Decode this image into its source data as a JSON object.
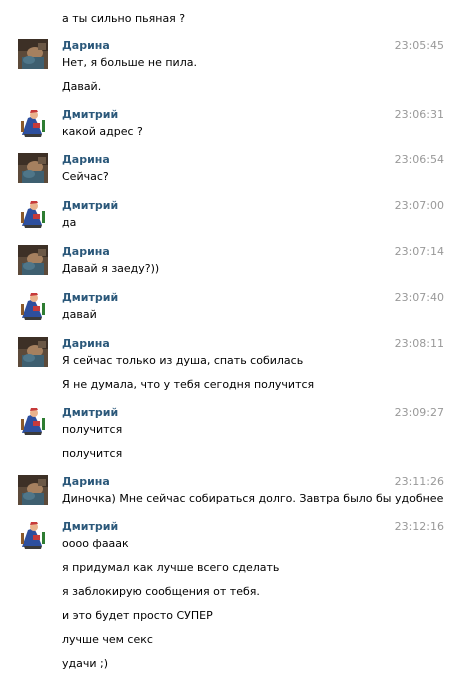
{
  "colors": {
    "author": "#2b587a",
    "time": "#999999",
    "text": "#000000",
    "background": "#ffffff"
  },
  "top_line": "а ты сильно пьяная ?",
  "messages": [
    {
      "author": "Дарина",
      "avatar": "darina-avatar",
      "time": "23:05:45",
      "lines": [
        "Нет, я больше не пила.",
        "Давай."
      ]
    },
    {
      "author": "Дмитрий",
      "avatar": "dmitry-avatar",
      "time": "23:06:31",
      "lines": [
        "какой адрес ?"
      ]
    },
    {
      "author": "Дарина",
      "avatar": "darina-avatar",
      "time": "23:06:54",
      "lines": [
        "Сейчас?"
      ]
    },
    {
      "author": "Дмитрий",
      "avatar": "dmitry-avatar",
      "time": "23:07:00",
      "lines": [
        "да"
      ]
    },
    {
      "author": "Дарина",
      "avatar": "darina-avatar",
      "time": "23:07:14",
      "lines": [
        "Давай я заеду?))"
      ]
    },
    {
      "author": "Дмитрий",
      "avatar": "dmitry-avatar",
      "time": "23:07:40",
      "lines": [
        "давай"
      ]
    },
    {
      "author": "Дарина",
      "avatar": "darina-avatar",
      "time": "23:08:11",
      "lines": [
        "Я сейчас только из душа, спать собилась",
        "Я не думала, что у тебя сегодня получится"
      ]
    },
    {
      "author": "Дмитрий",
      "avatar": "dmitry-avatar",
      "time": "23:09:27",
      "lines": [
        "получится",
        "получится"
      ]
    },
    {
      "author": "Дарина",
      "avatar": "darina-avatar",
      "time": "23:11:26",
      "lines": [
        "Диночка) Мне сейчас собираться долго. Завтра было бы удобнее"
      ]
    },
    {
      "author": "Дмитрий",
      "avatar": "dmitry-avatar",
      "time": "23:12:16",
      "lines": [
        "оооо фааак",
        "я придумал как лучше всего сделать",
        "я заблокирую сообщения от тебя.",
        "и это будет просто СУПЕР",
        "лучше чем секс",
        "удачи ;)"
      ]
    }
  ]
}
